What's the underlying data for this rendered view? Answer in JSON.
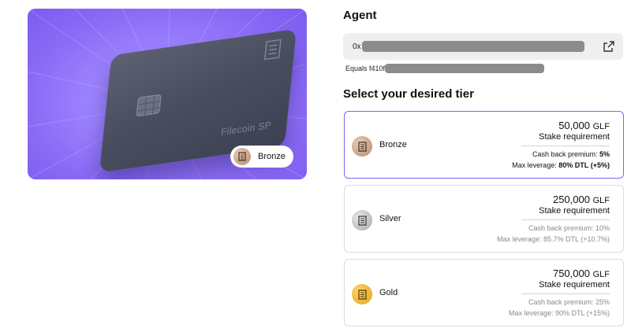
{
  "hero": {
    "card_text": "Filecoin SP",
    "badge_label": "Bronze",
    "background_color": "#8a6bf6"
  },
  "agent": {
    "title": "Agent",
    "address_prefix": "0x",
    "equals_prefix": "Equals f410f",
    "action_icon": "external-link-icon"
  },
  "tiers_section": {
    "title": "Select your desired tier",
    "selected": "Bronze",
    "accent_color": "#7c66ef",
    "tiers": [
      {
        "name": "Bronze",
        "amount": "50,000",
        "unit": "GLF",
        "stake_label": "Stake requirement",
        "cashback_label": "Cash back premium: ",
        "cashback_value": "5%",
        "leverage_label": "Max leverage: ",
        "leverage_value": "80% DTL",
        "leverage_delta": "(+5%)",
        "coin_color": "#c99a7e"
      },
      {
        "name": "Silver",
        "amount": "250,000",
        "unit": "GLF",
        "stake_label": "Stake requirement",
        "cashback_label": "Cash back premium: ",
        "cashback_value": "10%",
        "leverage_label": "Max leverage: ",
        "leverage_value": "85.7% DTL",
        "leverage_delta": "(+10.7%)",
        "coin_color": "#bdbdbd"
      },
      {
        "name": "Gold",
        "amount": "750,000",
        "unit": "GLF",
        "stake_label": "Stake requirement",
        "cashback_label": "Cash back premium: ",
        "cashback_value": "25%",
        "leverage_label": "Max leverage: ",
        "leverage_value": "90% DTL",
        "leverage_delta": "(+15%)",
        "coin_color": "#f0b93a"
      }
    ]
  }
}
